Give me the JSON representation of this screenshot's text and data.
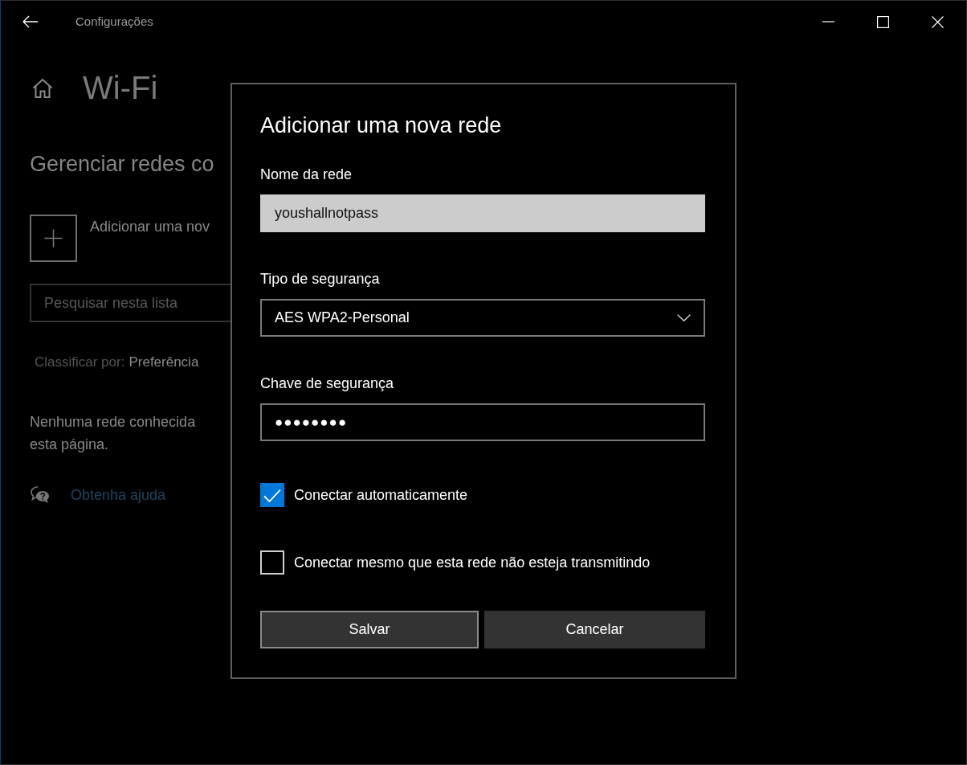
{
  "window": {
    "title": "Configurações"
  },
  "page": {
    "title": "Wi-Fi",
    "heading": "Gerenciar redes co",
    "add_network": "Adicionar uma nov",
    "search": {
      "placeholder": "Pesquisar nesta lista"
    },
    "sort": {
      "label": "Classificar por:",
      "value": "Preferência"
    },
    "empty_message": [
      "Nenhuma rede conhecida",
      "esta página."
    ],
    "help_link": "Obtenha ajuda"
  },
  "dialog": {
    "title": "Adicionar uma nova rede",
    "fields": [
      {
        "kind": "text",
        "label": "Nome da rede",
        "value": "youshallnotpass",
        "focused": true
      },
      {
        "kind": "select",
        "label": "Tipo de segurança",
        "value": "AES WPA2-Personal",
        "focused": false
      },
      {
        "kind": "password",
        "label": "Chave de segurança",
        "value": "●●●●●●●●",
        "focused": false
      }
    ],
    "checkboxes": [
      {
        "label": "Conectar automaticamente",
        "checked": true
      },
      {
        "label": "Conectar mesmo que esta rede não esteja transmitindo",
        "checked": false
      }
    ],
    "buttons": [
      {
        "label": "Salvar",
        "focused": true
      },
      {
        "label": "Cancelar",
        "focused": false
      }
    ]
  }
}
